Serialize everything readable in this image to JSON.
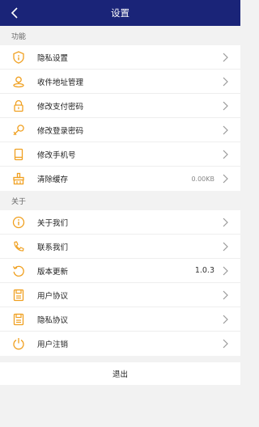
{
  "header": {
    "title": "设置",
    "back_icon": "chevron-left-icon"
  },
  "sections": [
    {
      "title": "功能",
      "items": [
        {
          "label": "隐私设置",
          "icon": "privacy-shield-icon",
          "value": ""
        },
        {
          "label": "收件地址管理",
          "icon": "location-person-icon",
          "value": ""
        },
        {
          "label": "修改支付密码",
          "icon": "lock-icon",
          "value": ""
        },
        {
          "label": "修改登录密码",
          "icon": "key-icon",
          "value": ""
        },
        {
          "label": "修改手机号",
          "icon": "phone-book-icon",
          "value": ""
        },
        {
          "label": "清除缓存",
          "icon": "broom-icon",
          "value": "0.00KB"
        }
      ]
    },
    {
      "title": "关于",
      "items": [
        {
          "label": "关于我们",
          "icon": "info-icon",
          "value": ""
        },
        {
          "label": "联系我们",
          "icon": "phone-call-icon",
          "value": ""
        },
        {
          "label": "版本更新",
          "icon": "refresh-icon",
          "value": "1.0.3"
        },
        {
          "label": "用户协议",
          "icon": "document-icon",
          "value": ""
        },
        {
          "label": "隐私协议",
          "icon": "document-icon",
          "value": ""
        },
        {
          "label": "用户注销",
          "icon": "power-icon",
          "value": ""
        }
      ]
    }
  ],
  "logout_label": "退出",
  "colors": {
    "header_bg": "#1a2478",
    "icon_accent": "#f0a020"
  }
}
